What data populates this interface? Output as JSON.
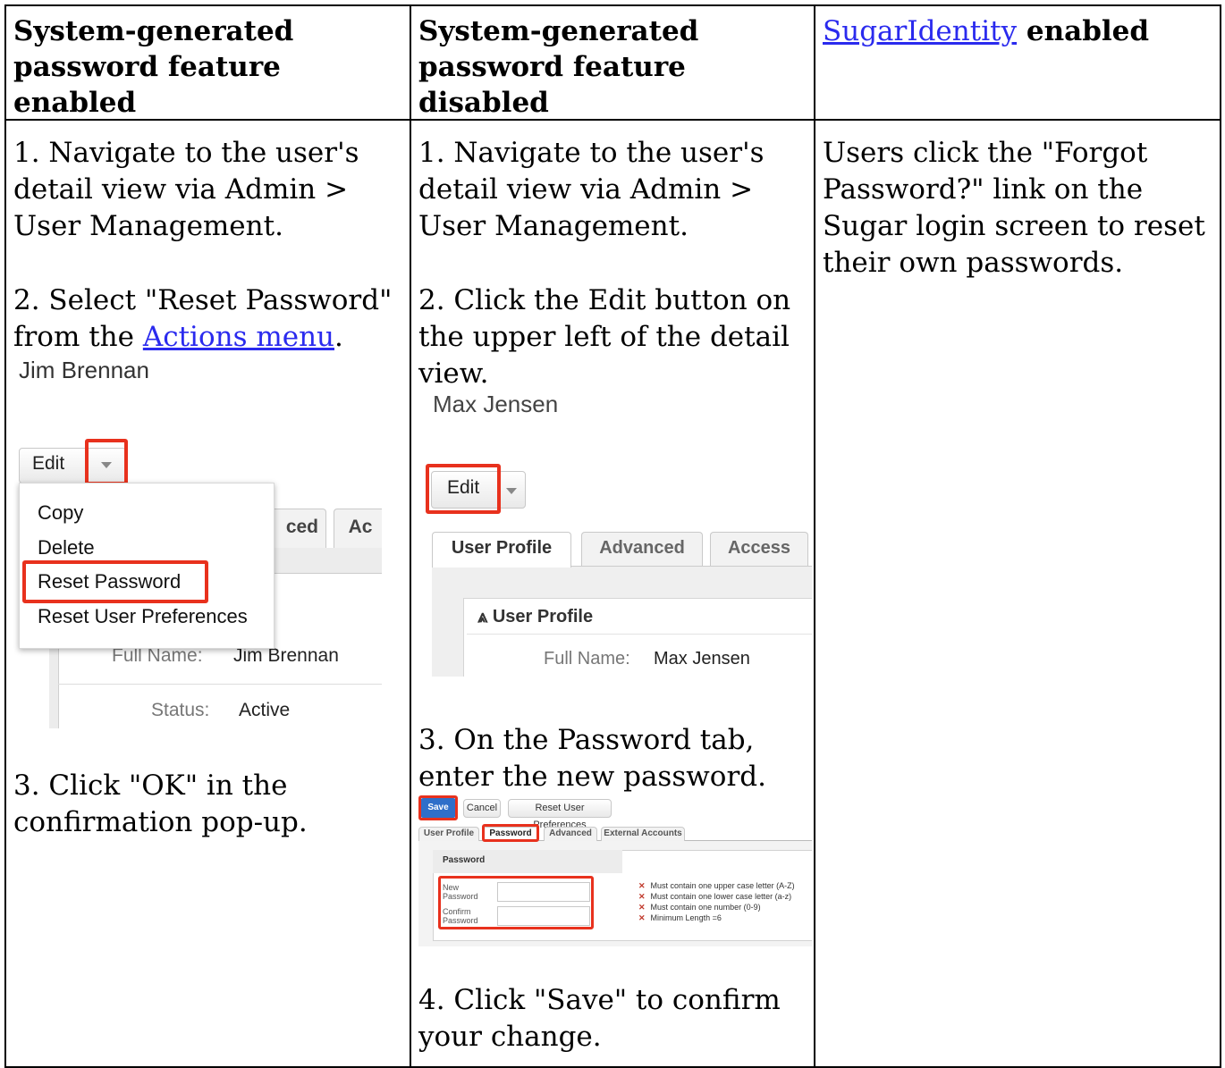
{
  "headers": {
    "col1": "System-generated password feature enabled",
    "col2": "System-generated password feature disabled",
    "col3_link": "SugarIdentity",
    "col3_rest": " enabled"
  },
  "col1": {
    "step1": "1. Navigate to the user's detail view via Admin > User Management.",
    "step2_prefix": "2. Select \"Reset Password\" from the ",
    "step2_link": "Actions menu",
    "step2_suffix": ".",
    "step3": "3. Click \"OK\" in the confirmation pop-up.",
    "shot": {
      "user_name": "Jim Brennan",
      "edit_label": "Edit",
      "menu_items": [
        "Copy",
        "Delete",
        "Reset Password",
        "Reset User Preferences"
      ],
      "tab_partial_1": "ced",
      "tab_partial_2": "Ac",
      "full_name_label": "Full Name:",
      "full_name_value": "Jim Brennan",
      "status_label": "Status:",
      "status_value": "Active"
    }
  },
  "col2": {
    "step1": "1. Navigate to the user's detail view via Admin > User Management.",
    "step2": "2. Click the Edit button on the upper left of the detail view.",
    "step3": "3. On the Password tab, enter the new password.",
    "step4": "4. Click \"Save\" to confirm your change.",
    "shot1": {
      "user_name": "Max Jensen",
      "edit_label": "Edit",
      "tabs": [
        "User Profile",
        "Advanced",
        "Access"
      ],
      "panel_title": "User Profile",
      "full_name_label": "Full Name:",
      "full_name_value": "Max Jensen"
    },
    "shot2": {
      "buttons": [
        "Save",
        "Cancel",
        "Reset User Preferences"
      ],
      "tabs": [
        "User Profile",
        "Password",
        "Advanced",
        "External Accounts"
      ],
      "panel_title": "Password",
      "new_password_label": "New Password",
      "confirm_password_label": "Confirm Password",
      "rules": [
        "Must contain one upper case letter (A-Z)",
        "Must contain one lower case letter (a-z)",
        "Must contain one number (0-9)",
        "Minimum Length =6"
      ]
    }
  },
  "col3": {
    "text": "Users click the \"Forgot Password?\" link on the Sugar login screen to reset their own passwords."
  }
}
